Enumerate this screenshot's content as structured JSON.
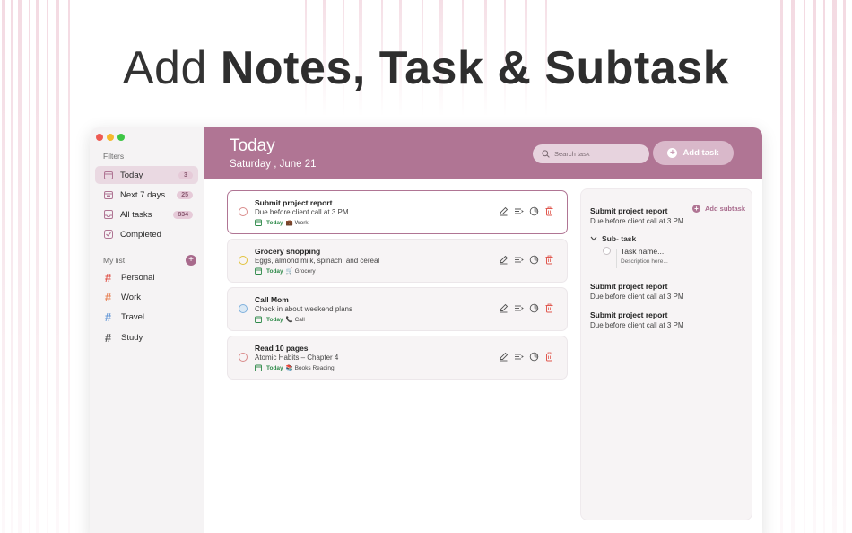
{
  "hero": {
    "light": "Add ",
    "bold": "Notes, Task & Subtask"
  },
  "colors": {
    "accent": "#b07594",
    "today_green": "#2f8a4a",
    "delete_red": "#e0584f"
  },
  "sidebar": {
    "filters_label": "Filters",
    "filters": [
      {
        "label": "Today",
        "count": "3",
        "icon": "calendar-icon",
        "active": true
      },
      {
        "label": "Next 7 days",
        "count": "25",
        "icon": "calendar-week-icon"
      },
      {
        "label": "All tasks",
        "count": "834",
        "icon": "inbox-icon"
      },
      {
        "label": "Completed",
        "count": "",
        "icon": "check-square-icon"
      }
    ],
    "mylist_label": "My list",
    "lists": [
      {
        "label": "Personal",
        "color": "#e0584f"
      },
      {
        "label": "Work",
        "color": "#e8855a"
      },
      {
        "label": "Travel",
        "color": "#6a9bd8"
      },
      {
        "label": "Study",
        "color": "#555555"
      }
    ]
  },
  "header": {
    "title": "Today",
    "date": "Saturday , June 21",
    "search_placeholder": "Search task",
    "add_task_label": "Add task"
  },
  "tasks": [
    {
      "title": "Submit project report",
      "desc": "Due before client call at 3 PM",
      "today": "Today",
      "tag": "💼 Work",
      "circle": "#d98a8a",
      "selected": true
    },
    {
      "title": "Grocery shopping",
      "desc": "Eggs, almond milk, spinach, and cereal",
      "today": "Today",
      "tag": "🛒 Grocery",
      "circle": "#e2c23a"
    },
    {
      "title": "Call Mom",
      "desc": "Check in about weekend plans",
      "today": "Today",
      "tag": "📞 Call",
      "circle": "#7fb0dc"
    },
    {
      "title": "Read 10 pages",
      "desc": "Atomic Habits – Chapter 4",
      "today": "Today",
      "tag": "📚 Books Reading",
      "circle": "#d98a8a"
    }
  ],
  "detail": {
    "add_subtask_label": "Add subtask",
    "main": {
      "title": "Submit project report",
      "desc": "Due before client call at 3 PM"
    },
    "subtask_header": "Sub- task",
    "subtask": {
      "name": "Task name...",
      "desc": "Description here..."
    },
    "others": [
      {
        "title": "Submit project report",
        "desc": "Due before client call at 3 PM"
      },
      {
        "title": "Submit project report",
        "desc": "Due before client call at 3 PM"
      }
    ]
  }
}
